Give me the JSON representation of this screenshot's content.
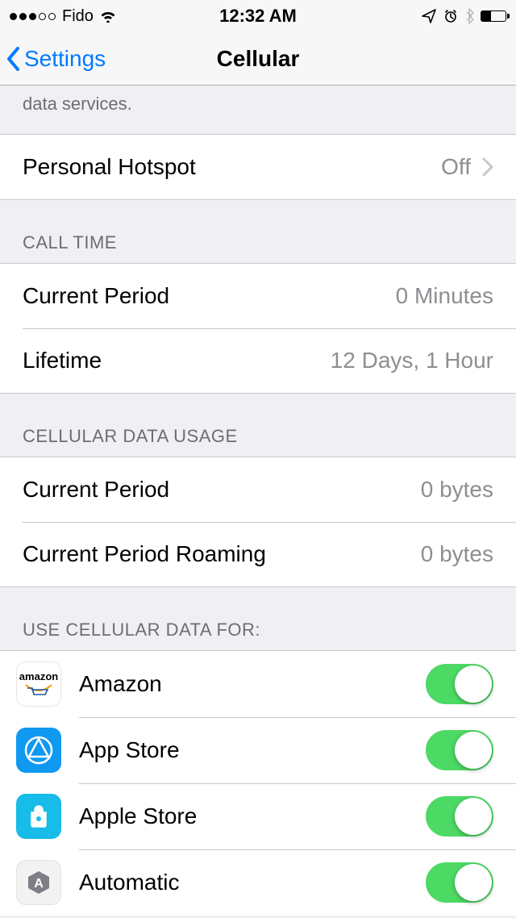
{
  "status": {
    "carrier": "Fido",
    "time": "12:32 AM"
  },
  "nav": {
    "back": "Settings",
    "title": "Cellular"
  },
  "desc_fragment": "data services.",
  "hotspot": {
    "label": "Personal Hotspot",
    "value": "Off"
  },
  "sections": {
    "call_time": {
      "header": "CALL TIME",
      "rows": [
        {
          "label": "Current Period",
          "value": "0 Minutes"
        },
        {
          "label": "Lifetime",
          "value": "12 Days, 1 Hour"
        }
      ]
    },
    "data_usage": {
      "header": "CELLULAR DATA USAGE",
      "rows": [
        {
          "label": "Current Period",
          "value": "0 bytes"
        },
        {
          "label": "Current Period Roaming",
          "value": "0 bytes"
        }
      ]
    },
    "apps": {
      "header": "USE CELLULAR DATA FOR:",
      "items": [
        {
          "label": "Amazon",
          "on": true
        },
        {
          "label": "App Store",
          "on": true
        },
        {
          "label": "Apple Store",
          "on": true
        },
        {
          "label": "Automatic",
          "on": true
        }
      ]
    }
  }
}
